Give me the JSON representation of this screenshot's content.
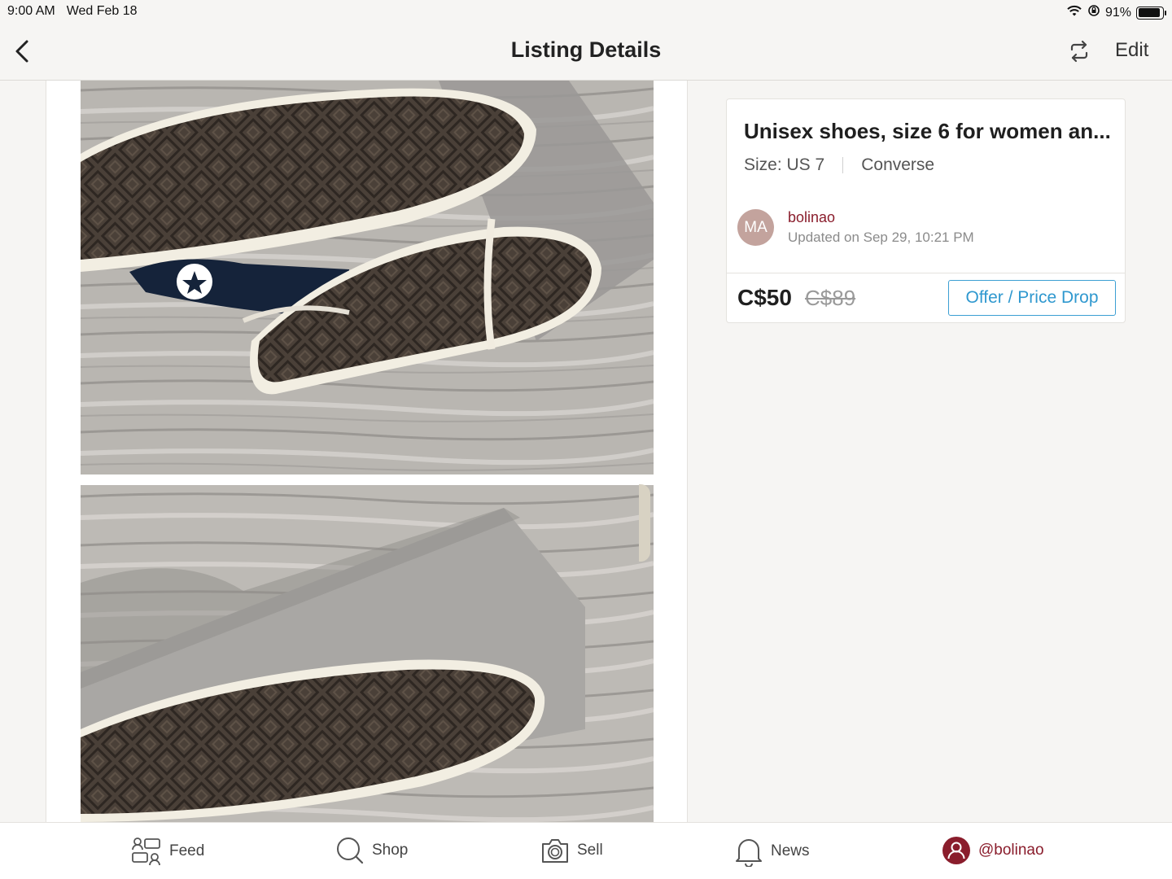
{
  "status_bar": {
    "time": "9:00 AM",
    "date": "Wed Feb 18",
    "battery": "91%",
    "battery_level": 0.91,
    "icons": [
      "wifi-icon",
      "orientation-lock-icon",
      "battery-icon"
    ]
  },
  "nav": {
    "title": "Listing Details",
    "edit_label": "Edit",
    "icons": [
      "back-chevron-icon",
      "refresh-icon"
    ]
  },
  "listing": {
    "title": "Unisex shoes, size 6 for women an...",
    "size": "Size: US 7",
    "brand": "Converse",
    "seller": {
      "initials": "MA",
      "username": "bolinao",
      "updated": "Updated on Sep 29, 10:21 PM"
    },
    "price": "C$50",
    "original_price": "C$89",
    "offer_button": "Offer / Price Drop"
  },
  "tabs": [
    {
      "label": "Feed",
      "icon": "feed-icon"
    },
    {
      "label": "Shop",
      "icon": "search-icon"
    },
    {
      "label": "Sell",
      "icon": "camera-icon"
    },
    {
      "label": "News",
      "icon": "bell-icon"
    },
    {
      "label": "@bolinao",
      "icon": "profile-icon"
    }
  ],
  "colors": {
    "background": "#f6f5f3",
    "brand": "#8a1d2c",
    "offer_blue": "#2f98cf",
    "avatar": "#c3a39d"
  }
}
